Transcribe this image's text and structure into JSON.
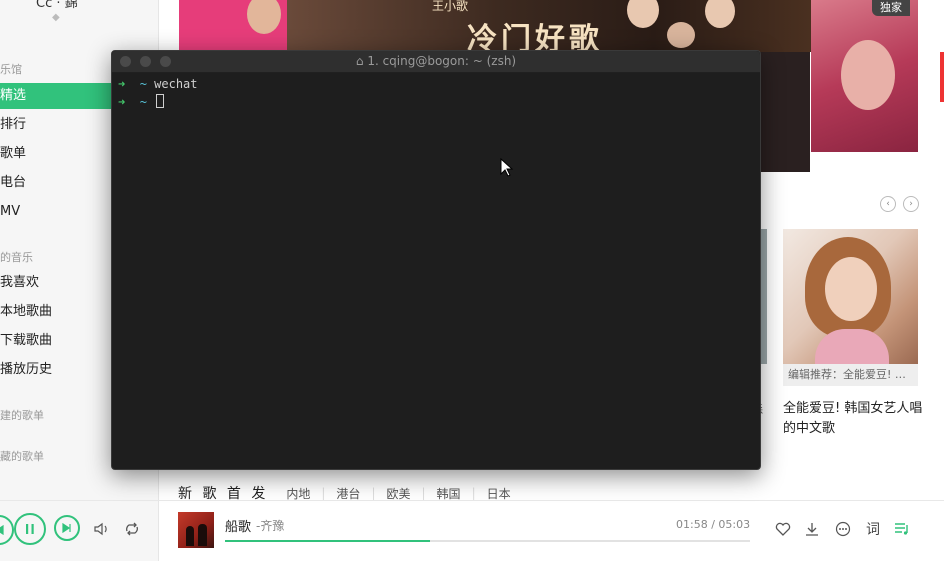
{
  "sidebar": {
    "user_name": "Cc · 錦",
    "section_online": "乐馆",
    "online_items": [
      {
        "label": "精选",
        "active": true
      },
      {
        "label": "排行"
      },
      {
        "label": "歌单"
      },
      {
        "label": "电台"
      },
      {
        "label": "MV"
      }
    ],
    "section_mine": "的音乐",
    "mine_items": [
      {
        "label": "我喜欢"
      },
      {
        "label": "本地歌曲"
      },
      {
        "label": "下载歌曲"
      },
      {
        "label": "播放历史"
      }
    ],
    "section_created": "建的歌单",
    "section_collected": "藏的歌单"
  },
  "banner": {
    "main_text": "冷门好歌",
    "small_text": "王小歌",
    "badge": "独家"
  },
  "recommend": {
    "overlay": "编辑推荐：全能爱豆! …",
    "title": "全能爱豆! 韩国女艺人唱的中文歌",
    "stray_char": "森"
  },
  "new_songs": {
    "heading": "新 歌 首 发",
    "tabs": [
      "内地",
      "港台",
      "欧美",
      "韩国",
      "日本"
    ]
  },
  "player": {
    "song_title": "船歌",
    "artist": "-齐豫",
    "time": "01:58 / 05:03",
    "progress": 0.39,
    "lyrics_label": "词"
  },
  "terminal": {
    "title": "1. cqing@bogon: ~ (zsh)",
    "lines": [
      {
        "arrow": "➜",
        "dir": "~",
        "cmd": "wechat"
      },
      {
        "arrow": "➜",
        "dir": "~",
        "cmd": ""
      }
    ]
  },
  "colors": {
    "accent": "#31c27c",
    "terminal_bg": "#1e1e1e",
    "prompt_arrow": "#43c46a"
  }
}
